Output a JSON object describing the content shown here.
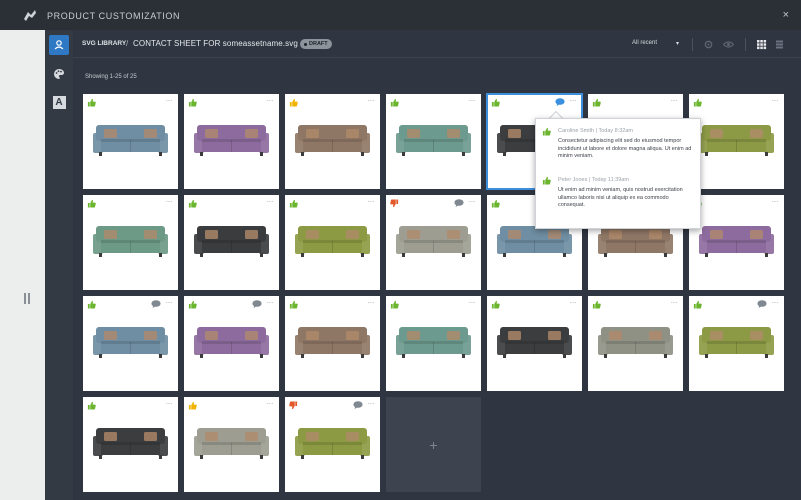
{
  "window": {
    "title": "PRODUCT CUSTOMIZATION",
    "close_label": "×"
  },
  "sidebar": {
    "items": [
      {
        "icon": "product-icon",
        "active": true
      },
      {
        "icon": "palette-icon",
        "active": false
      },
      {
        "icon": "font-icon",
        "label": "A",
        "active": false
      }
    ]
  },
  "header": {
    "library_label": "SVG LIBRARY",
    "separator": "/",
    "title": "CONTACT SHEET FOR someassetname.svg",
    "badge": "DRAFT",
    "sort_label": "All recent",
    "sort_caret": "▾"
  },
  "main": {
    "showing": "Showing 1-25 of 25",
    "add_label": "+"
  },
  "colors": {
    "accent": "#2f78c4",
    "thumb_up": "#6bb52f",
    "thumb_yellow": "#f0b400",
    "thumb_down": "#e2582a",
    "comment_grey": "#808891",
    "comment_blue": "#3b8fdf"
  },
  "tiles": [
    {
      "color": "#6f8ea3",
      "thumb": "up",
      "comment": null
    },
    {
      "color": "#8e6b9e",
      "thumb": "up",
      "comment": null
    },
    {
      "color": "#8f7766",
      "thumb": "yellow",
      "comment": null
    },
    {
      "color": "#6d9a8e",
      "thumb": "up",
      "comment": null
    },
    {
      "color": "#3c3d3f",
      "thumb": "up",
      "comment": "blue",
      "selected": true
    },
    {
      "color": "#8f9185",
      "thumb": "up",
      "comment": null
    },
    {
      "color": "#8d9a45",
      "thumb": "up",
      "comment": null
    },
    {
      "color": "#6d9a86",
      "thumb": "up",
      "comment": null
    },
    {
      "color": "#3a3c3e",
      "thumb": "up",
      "comment": null
    },
    {
      "color": "#8c9b43",
      "thumb": "up",
      "comment": null
    },
    {
      "color": "#9d9e91",
      "thumb": "down",
      "comment": "grey"
    },
    {
      "color": "#6f8ea3",
      "thumb": "up",
      "comment": null
    },
    {
      "color": "#8f7766",
      "thumb": "up",
      "comment": null
    },
    {
      "color": "#8e6b9e",
      "thumb": "up",
      "comment": null
    },
    {
      "color": "#6f8ea3",
      "thumb": "up",
      "comment": "grey"
    },
    {
      "color": "#8e6b9e",
      "thumb": "up",
      "comment": "grey"
    },
    {
      "color": "#8f7766",
      "thumb": "up",
      "comment": null
    },
    {
      "color": "#6d9a8e",
      "thumb": "up",
      "comment": null
    },
    {
      "color": "#3c3d3f",
      "thumb": "up",
      "comment": null
    },
    {
      "color": "#8f9185",
      "thumb": "up",
      "comment": null
    },
    {
      "color": "#8d9a45",
      "thumb": "up",
      "comment": "grey"
    },
    {
      "color": "#3c3d3f",
      "thumb": "up",
      "comment": null
    },
    {
      "color": "#9d9e91",
      "thumb": "yellow",
      "comment": null
    },
    {
      "color": "#8c9b43",
      "thumb": "down",
      "comment": "grey"
    }
  ],
  "popover": {
    "comments": [
      {
        "author": "Caroline Smith | Today 8:32am",
        "body": "Consectetur adipiscing elit sed do eiusmod tempor incididunt ut labore et dolore magna aliqua. Ut enim ad minim veniam."
      },
      {
        "author": "Peter Jones | Today 11:39am",
        "body": "Ut enim ad minim veniam, quis nostrud exercitation ullamco laboris nisi ut aliquip ex ea commodo consequat."
      }
    ]
  }
}
